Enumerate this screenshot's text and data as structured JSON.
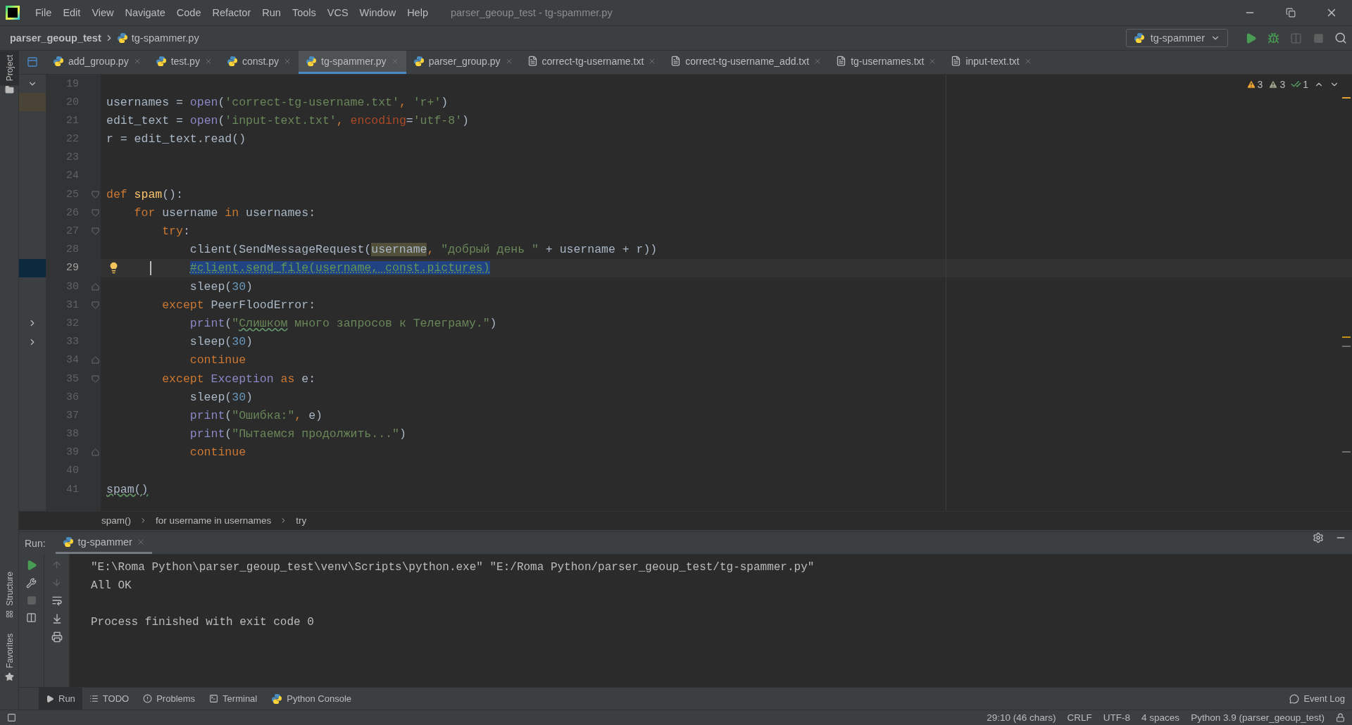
{
  "window": {
    "title": "parser_geoup_test - tg-spammer.py"
  },
  "menu": [
    "File",
    "Edit",
    "View",
    "Navigate",
    "Code",
    "Refactor",
    "Run",
    "Tools",
    "VCS",
    "Window",
    "Help"
  ],
  "navbar": {
    "project": "parser_geoup_test",
    "file": "tg-spammer.py",
    "run_config": "tg-spammer"
  },
  "side_tools": {
    "top": "Project",
    "middle": "Structure",
    "bottom": "Favorites"
  },
  "tabs": [
    {
      "label": "add_group.py",
      "kind": "py",
      "selected": false
    },
    {
      "label": "test.py",
      "kind": "py",
      "selected": false
    },
    {
      "label": "const.py",
      "kind": "py",
      "selected": false
    },
    {
      "label": "tg-spammer.py",
      "kind": "py",
      "selected": true
    },
    {
      "label": "parser_group.py",
      "kind": "py",
      "selected": false
    },
    {
      "label": "correct-tg-username.txt",
      "kind": "txt",
      "selected": false
    },
    {
      "label": "correct-tg-username_add.txt",
      "kind": "txt",
      "selected": false
    },
    {
      "label": "tg-usernames.txt",
      "kind": "txt",
      "selected": false
    },
    {
      "label": "input-text.txt",
      "kind": "txt",
      "selected": false
    }
  ],
  "inspections": [
    {
      "kind": "warning",
      "count": "3"
    },
    {
      "kind": "weak",
      "count": "3"
    },
    {
      "kind": "ok",
      "count": "1"
    }
  ],
  "editor": {
    "lines": [
      {
        "number": "19",
        "current": false
      },
      {
        "number": "20",
        "current": false,
        "tokens": [
          {
            "t": "usernames = ",
            "kind": "plain"
          },
          {
            "t": "open",
            "kind": "builtin"
          },
          {
            "t": "(",
            "kind": "plain"
          },
          {
            "t": "'correct-tg-username.txt'",
            "kind": "string"
          },
          {
            "t": ", ",
            "kind": "punct"
          },
          {
            "t": "'r+'",
            "kind": "string"
          },
          {
            "t": ")",
            "kind": "plain"
          }
        ]
      },
      {
        "number": "21",
        "current": false,
        "tokens": [
          {
            "t": "edit_text = ",
            "kind": "plain"
          },
          {
            "t": "open",
            "kind": "builtin"
          },
          {
            "t": "(",
            "kind": "plain"
          },
          {
            "t": "'input-text.txt'",
            "kind": "string"
          },
          {
            "t": ", ",
            "kind": "punct"
          },
          {
            "t": "encoding",
            "kind": "param"
          },
          {
            "t": "=",
            "kind": "plain"
          },
          {
            "t": "'utf-8'",
            "kind": "string"
          },
          {
            "t": ")",
            "kind": "plain"
          }
        ]
      },
      {
        "number": "22",
        "current": false,
        "tokens": [
          {
            "t": "r = edit_text.read()",
            "kind": "plain"
          }
        ]
      },
      {
        "number": "23",
        "current": false
      },
      {
        "number": "24",
        "current": false
      },
      {
        "number": "25",
        "current": false,
        "fold": {
          "kind": "start"
        },
        "tokens": [
          {
            "t": "def ",
            "kind": "keyword"
          },
          {
            "t": "spam",
            "kind": "function"
          },
          {
            "t": "():",
            "kind": "plain"
          }
        ]
      },
      {
        "number": "26",
        "current": false,
        "fold": {
          "kind": "start"
        },
        "tokens": [
          {
            "t": "    for",
            "kind": "keyword"
          },
          {
            "t": " username ",
            "kind": "plain"
          },
          {
            "t": "in",
            "kind": "keyword"
          },
          {
            "t": " usernames:",
            "kind": "plain"
          }
        ]
      },
      {
        "number": "27",
        "current": false,
        "fold": {
          "kind": "start"
        },
        "tokens": [
          {
            "t": "        try",
            "kind": "keyword"
          },
          {
            "t": ":",
            "kind": "plain"
          }
        ]
      },
      {
        "number": "28",
        "current": false,
        "tokens": [
          {
            "t": "            client(SendMessageRequest(",
            "kind": "plain"
          },
          {
            "t": "username",
            "kind": "match"
          },
          {
            "t": ", ",
            "kind": "punct"
          },
          {
            "t": "\"добрый день \"",
            "kind": "string"
          },
          {
            "t": " + username + r))",
            "kind": "plain"
          }
        ]
      },
      {
        "number": "29",
        "current": true,
        "tokens": [
          {
            "t": "            #client.send_file(username, const.pictures)",
            "kind": "selection"
          }
        ]
      },
      {
        "number": "30",
        "current": false,
        "fold": {
          "kind": "end"
        },
        "tokens": [
          {
            "t": "            sleep(",
            "kind": "plain"
          },
          {
            "t": "30",
            "kind": "number"
          },
          {
            "t": ")",
            "kind": "plain"
          }
        ]
      },
      {
        "number": "31",
        "current": false,
        "fold": {
          "kind": "start"
        },
        "tokens": [
          {
            "t": "        except",
            "kind": "keyword"
          },
          {
            "t": " PeerFloodError:",
            "kind": "plain"
          }
        ]
      },
      {
        "number": "32",
        "current": false,
        "tokens": [
          {
            "t": "            print",
            "kind": "builtin"
          },
          {
            "t": "(",
            "kind": "plain"
          },
          {
            "t": "\"",
            "kind": "string"
          },
          {
            "t": "Слишком",
            "kind": "typo"
          },
          {
            "t": " много запросов к Телеграму.\"",
            "kind": "string"
          },
          {
            "t": ")",
            "kind": "plain"
          }
        ]
      },
      {
        "number": "33",
        "current": false,
        "tokens": [
          {
            "t": "            sleep(",
            "kind": "plain"
          },
          {
            "t": "30",
            "kind": "number"
          },
          {
            "t": ")",
            "kind": "plain"
          }
        ]
      },
      {
        "number": "34",
        "current": false,
        "fold": {
          "kind": "end"
        },
        "tokens": [
          {
            "t": "            continue",
            "kind": "keyword"
          }
        ]
      },
      {
        "number": "35",
        "current": false,
        "fold": {
          "kind": "start"
        },
        "tokens": [
          {
            "t": "        except",
            "kind": "keyword"
          },
          {
            "t": " Exception",
            "kind": "builtin"
          },
          {
            "t": " as",
            "kind": "keyword"
          },
          {
            "t": " e:",
            "kind": "plain"
          }
        ]
      },
      {
        "number": "36",
        "current": false,
        "tokens": [
          {
            "t": "            sleep(",
            "kind": "plain"
          },
          {
            "t": "30",
            "kind": "number"
          },
          {
            "t": ")",
            "kind": "plain"
          }
        ]
      },
      {
        "number": "37",
        "current": false,
        "tokens": [
          {
            "t": "            print",
            "kind": "builtin"
          },
          {
            "t": "(",
            "kind": "plain"
          },
          {
            "t": "\"Ошибка:\"",
            "kind": "string"
          },
          {
            "t": ", ",
            "kind": "punct"
          },
          {
            "t": "e)",
            "kind": "plain"
          }
        ]
      },
      {
        "number": "38",
        "current": false,
        "tokens": [
          {
            "t": "            print",
            "kind": "builtin"
          },
          {
            "t": "(",
            "kind": "plain"
          },
          {
            "t": "\"Пытаемся продолжить...\"",
            "kind": "string"
          },
          {
            "t": ")",
            "kind": "plain"
          }
        ]
      },
      {
        "number": "39",
        "current": false,
        "fold": {
          "kind": "end"
        },
        "tokens": [
          {
            "t": "            continue",
            "kind": "keyword"
          }
        ]
      },
      {
        "number": "40",
        "current": false
      },
      {
        "number": "41",
        "current": false,
        "tokens": [
          {
            "t": "spam()",
            "kind": "typo"
          }
        ]
      }
    ]
  },
  "breadcrumbs": [
    "spam()",
    "for username in usernames",
    "try"
  ],
  "run": {
    "label": "Run:",
    "tab": "tg-spammer",
    "output": [
      {
        "text": "\"E:\\Roma Python\\parser_geoup_test\\venv\\Scripts\\python.exe\" \"E:/Roma Python/parser_geoup_test/tg-spammer.py\"",
        "kind": "command"
      },
      {
        "text": "All OK",
        "kind": "stdout"
      },
      {
        "text": "Process finished with exit code 0",
        "kind": "exit"
      }
    ]
  },
  "tool_tabs": [
    {
      "label": "Run",
      "kind": "run",
      "selected": true
    },
    {
      "label": "TODO",
      "kind": "todo",
      "selected": false
    },
    {
      "label": "Problems",
      "kind": "problems",
      "selected": false
    },
    {
      "label": "Terminal",
      "kind": "terminal",
      "selected": false
    },
    {
      "label": "Python Console",
      "kind": "console",
      "selected": false
    }
  ],
  "event_log": "Event Log",
  "status": [
    "29:10 (46 chars)",
    "CRLF",
    "UTF-8",
    "4 spaces",
    "Python 3.9 (parser_geoup_test)"
  ]
}
